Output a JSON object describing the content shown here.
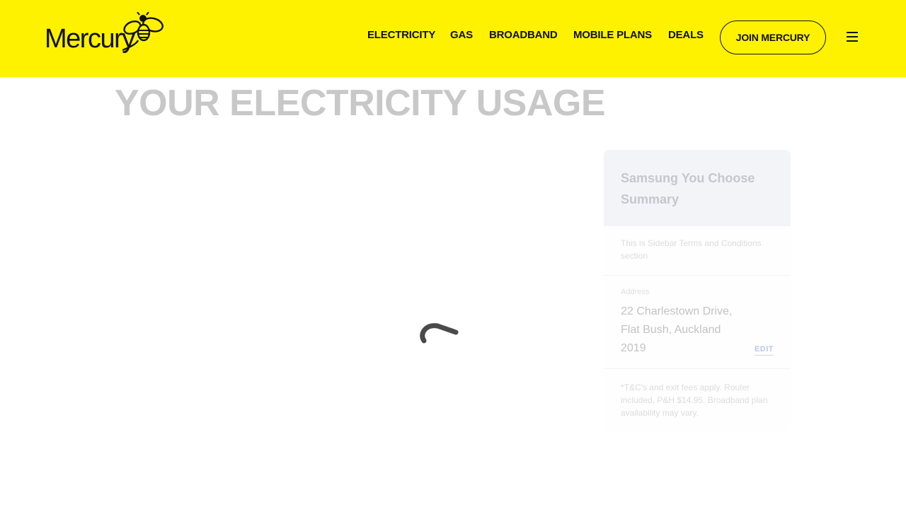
{
  "header": {
    "logo_text": "Mercury",
    "logo_icon": "bee-logo-icon",
    "nav": [
      {
        "label": "ELECTRICITY"
      },
      {
        "label": "GAS"
      },
      {
        "label": "BROADBAND"
      },
      {
        "label": "MOBILE PLANS"
      },
      {
        "label": "DEALS"
      }
    ],
    "join_label": "JOIN MERCURY",
    "menu_icon": "hamburger-menu-icon",
    "background_color": "#fff200"
  },
  "main": {
    "title": "YOUR ELECTRICITY USAGE",
    "loading_icon": "loading-spinner-icon"
  },
  "sidebar": {
    "title": "Samsung You Choose Summary",
    "terms_text": "This is Sidebar Terms and Conditions section",
    "address_label": "Address",
    "address_line1": "22 Charlestown Drive,",
    "address_line2": "Flat Bush, Auckland",
    "address_line3": "2019",
    "edit_label": "EDIT",
    "disclaimer": "*T&C's and exit fees apply. Router included, P&H $14.95. Broadband plan availability may vary."
  }
}
